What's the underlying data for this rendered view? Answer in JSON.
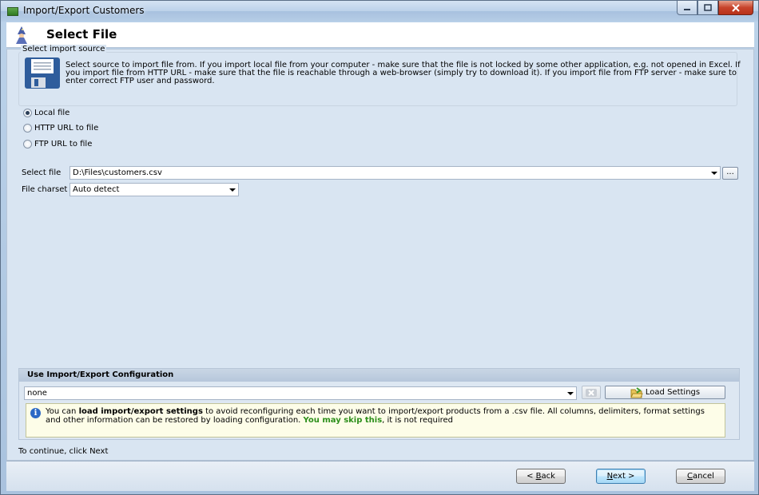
{
  "window": {
    "title": "Import/Export Customers"
  },
  "header": {
    "title": "Select File"
  },
  "info": {
    "text": "Select source to import file from. If you import local file from your computer - make sure that the file is not locked by some other application, e.g. not opened in Excel. If you import file from HTTP URL - make sure that the file is reachable through a web-browser (simply try to download it). If you import file from FTP server - make sure to enter correct FTP user and password."
  },
  "import_source": {
    "label": "Select import source",
    "options": [
      "Local file",
      "HTTP URL to file",
      "FTP URL to file"
    ],
    "selected": "Local file"
  },
  "select_file": {
    "label": "Select file",
    "value": "D:\\Files\\customers.csv",
    "browse_label": "..."
  },
  "file_charset": {
    "label": "File charset",
    "value": "Auto detect"
  },
  "config": {
    "heading": "Use Import/Export Configuration",
    "value": "none",
    "load_button": "Load Settings",
    "note_pre": "You can ",
    "note_bold": "load import/export settings",
    "note_mid": " to avoid reconfiguring each time you want to import/export products from a .csv file. All columns, delimiters, format settings and other information can be restored by loading configuration. ",
    "note_green": "You may skip this",
    "note_post": ", it is not required"
  },
  "status": {
    "continue_text": "To continue, click Next"
  },
  "footer": {
    "back_prefix": "< ",
    "back_key": "B",
    "back_rest": "ack",
    "next_key": "N",
    "next_rest": "ext >",
    "cancel_key": "C",
    "cancel_rest": "ancel"
  }
}
